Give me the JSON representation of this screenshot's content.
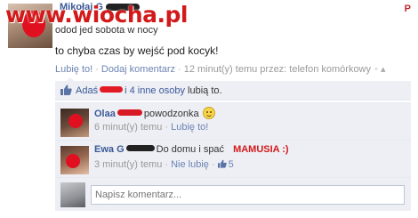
{
  "watermark": "www.wiocha.pl",
  "corner_mark": "P",
  "post": {
    "author": "Mikołaj G",
    "line1": "odod jed sobota w nocy",
    "line2": "to chyba czas by wejść pod kocyk!",
    "actions": {
      "like": "Lubię to!",
      "comment": "Dodaj komentarz",
      "time": "12 minut(y) temu przez: telefon komórkowy"
    }
  },
  "likes": {
    "prefix": "Adaś",
    "others_link": "i 4 inne osoby",
    "suffix": "lubią to."
  },
  "comments": [
    {
      "name": "Olaa",
      "text": "powodzonka",
      "time": "6 minut(y) temu",
      "like_label": "Lubię to!"
    },
    {
      "name": "Ewa G",
      "text": "Do domu i spać",
      "annotation": "MAMUSIA :)",
      "time": "3 minut(y) temu",
      "like_label": "Nie lubię",
      "like_count": "5"
    }
  ],
  "composer": {
    "placeholder": "Napisz komentarz..."
  },
  "colors": {
    "link": "#3b5998",
    "meta": "#999999",
    "feedback_bg": "#edeff4",
    "annotation": "#d21a1a"
  },
  "icons": [
    "thumbs-up-icon",
    "smiley-icon",
    "globe-icon"
  ]
}
